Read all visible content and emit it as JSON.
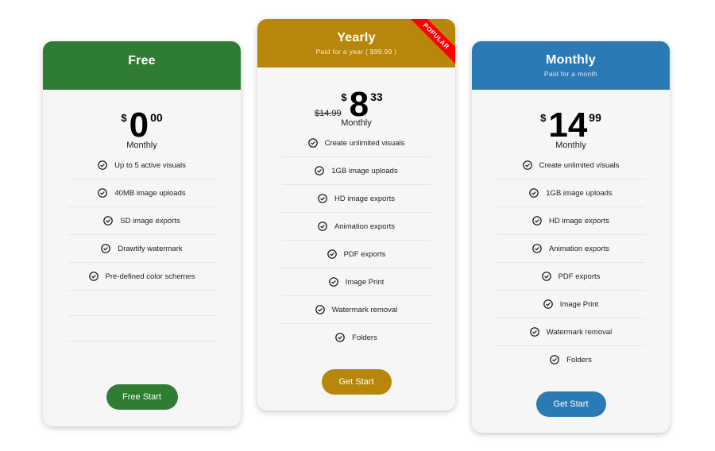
{
  "colors": {
    "free": "#2e7d32",
    "yearly": "#b8860b",
    "monthly": "#2a7ab5",
    "ribbon": "#ff0000"
  },
  "plans": [
    {
      "title": "Free",
      "subtitle": "",
      "currency": "$",
      "price_integer": "0",
      "price_decimal": "00",
      "old_price": "",
      "period": "Monthly",
      "features": [
        "Up to 5 active visuals",
        "40MB image uploads",
        "SD image exports",
        "Drawtify watermark",
        "Pre-defined color schemes"
      ],
      "button_label": "Free Start"
    },
    {
      "title": "Yearly",
      "subtitle": "Paid for a year ( $99.99 )",
      "ribbon": "POPULAR",
      "currency": "$",
      "price_integer": "8",
      "price_decimal": "33",
      "old_price": "$14.99",
      "period": "Monthly",
      "features": [
        "Create unlimited visuals",
        "1GB image uploads",
        "HD image exports",
        "Animation exports",
        "PDF exports",
        "Image Print",
        "Watermark removal",
        "Folders"
      ],
      "button_label": "Get Start"
    },
    {
      "title": "Monthly",
      "subtitle": "Paid for a month",
      "currency": "$",
      "price_integer": "14",
      "price_decimal": "99",
      "old_price": "",
      "period": "Monthly",
      "features": [
        "Create unlimited visuals",
        "1GB image uploads",
        "HD image exports",
        "Animation exports",
        "PDF exports",
        "Image Print",
        "Watermark removal",
        "Folders"
      ],
      "button_label": "Get Start"
    }
  ]
}
